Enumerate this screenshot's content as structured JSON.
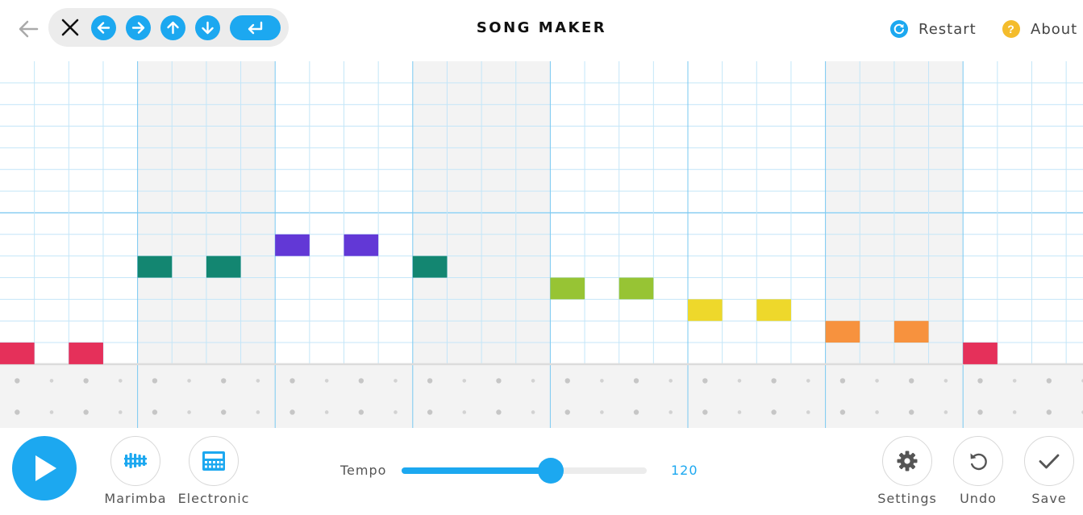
{
  "header": {
    "title": "SONG MAKER",
    "restart_label": "Restart",
    "about_label": "About",
    "about_glyph": "?",
    "icons": {
      "back": "left-arrow-icon",
      "keyboard_controls": [
        "close-icon",
        "arrow-left-icon",
        "arrow-right-icon",
        "arrow-up-icon",
        "arrow-down-icon",
        "enter-icon"
      ],
      "restart": "refresh-icon",
      "about": "question-icon"
    }
  },
  "grid": {
    "columns": 32,
    "melody_rows": 14,
    "percussion_rows": 2,
    "octave_divider_after_row": 7,
    "beats_per_bar": 4,
    "shaded_bars": [
      1,
      3,
      6
    ],
    "notes": [
      {
        "col": 0,
        "row": 13,
        "color": "#e5305a"
      },
      {
        "col": 2,
        "row": 13,
        "color": "#e5305a"
      },
      {
        "col": 4,
        "row": 9,
        "color": "#138671"
      },
      {
        "col": 6,
        "row": 9,
        "color": "#138671"
      },
      {
        "col": 8,
        "row": 8,
        "color": "#6238d6"
      },
      {
        "col": 10,
        "row": 8,
        "color": "#6238d6"
      },
      {
        "col": 12,
        "row": 9,
        "color": "#138671"
      },
      {
        "col": 16,
        "row": 10,
        "color": "#97c434"
      },
      {
        "col": 18,
        "row": 10,
        "color": "#97c434"
      },
      {
        "col": 20,
        "row": 11,
        "color": "#eed82b"
      },
      {
        "col": 22,
        "row": 11,
        "color": "#eed82b"
      },
      {
        "col": 24,
        "row": 12,
        "color": "#f7923e"
      },
      {
        "col": 26,
        "row": 12,
        "color": "#f7923e"
      },
      {
        "col": 28,
        "row": 13,
        "color": "#e5305a"
      }
    ]
  },
  "controls": {
    "play": "play-icon",
    "instrument_label": "Marimba",
    "percussion_label": "Electronic",
    "tempo_label": "Tempo",
    "tempo_value": "120",
    "tempo_level": 0.61,
    "settings_label": "Settings",
    "undo_label": "Undo",
    "save_label": "Save"
  },
  "colors": {
    "accent": "#1ca8f0",
    "about_icon": "#f4bc2c",
    "grid_line": "#c4e6f8",
    "bar_line": "#79c9f2",
    "shaded_bar": "#f3f3f3"
  }
}
